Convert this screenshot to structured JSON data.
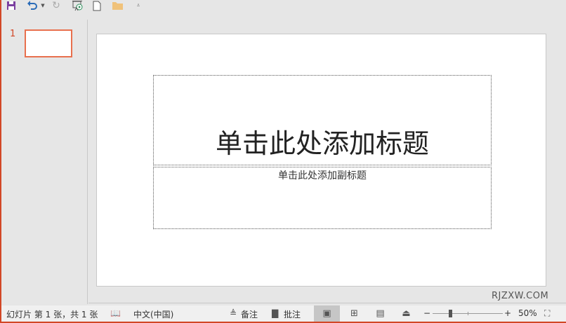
{
  "toolbar": {
    "icons": [
      "save-icon",
      "undo-icon",
      "undo-dropdown-icon",
      "redo-icon",
      "slideshow-icon",
      "new-file-icon",
      "open-folder-icon",
      "customize-toolbar-icon"
    ]
  },
  "thumbnails": [
    {
      "number": "1"
    }
  ],
  "slide": {
    "title_placeholder": "单击此处添加标题",
    "subtitle_placeholder": "单击此处添加副标题"
  },
  "watermark": "RJZXW.COM",
  "status": {
    "slide_info": "幻灯片 第 1 张，共 1 张",
    "language": "中文(中国)",
    "notes": "备注",
    "comments": "批注",
    "zoom": "50%",
    "zoom_level_percent": 50
  },
  "colors": {
    "accent": "#d24726",
    "thumb_border": "#e8704e"
  }
}
